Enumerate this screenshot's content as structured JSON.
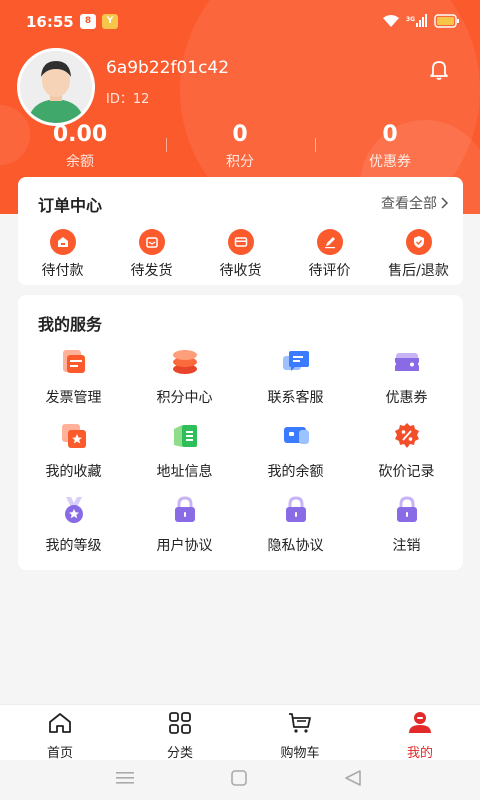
{
  "status_bar": {
    "time": "16:55",
    "badge1": "8",
    "badge2": "Y"
  },
  "profile": {
    "username": "6a9b22f01c42",
    "user_id": "ID：12"
  },
  "stats": [
    {
      "value": "0.00",
      "label": "余额"
    },
    {
      "value": "0",
      "label": "积分"
    },
    {
      "value": "0",
      "label": "优惠券"
    }
  ],
  "orders": {
    "title": "订单中心",
    "view_all": "查看全部",
    "items": [
      {
        "label": "待付款",
        "icon": "wallet-icon"
      },
      {
        "label": "待发货",
        "icon": "package-icon"
      },
      {
        "label": "待收货",
        "icon": "card-icon"
      },
      {
        "label": "待评价",
        "icon": "pen-icon"
      },
      {
        "label": "售后/退款",
        "icon": "shield-check-icon"
      }
    ]
  },
  "services": {
    "title": "我的服务",
    "items": [
      {
        "label": "发票管理",
        "icon": "invoice-icon"
      },
      {
        "label": "积分中心",
        "icon": "coin-stack-icon"
      },
      {
        "label": "联系客服",
        "icon": "chat-icon"
      },
      {
        "label": "优惠券",
        "icon": "coupon-icon"
      },
      {
        "label": "我的收藏",
        "icon": "favorite-icon"
      },
      {
        "label": "地址信息",
        "icon": "address-icon"
      },
      {
        "label": "我的余额",
        "icon": "balance-card-icon"
      },
      {
        "label": "砍价记录",
        "icon": "discount-badge-icon"
      },
      {
        "label": "我的等级",
        "icon": "medal-icon"
      },
      {
        "label": "用户协议",
        "icon": "lock-icon"
      },
      {
        "label": "隐私协议",
        "icon": "lock-icon"
      },
      {
        "label": "注销",
        "icon": "lock-icon"
      }
    ]
  },
  "nav": [
    {
      "label": "首页",
      "icon": "home-icon"
    },
    {
      "label": "分类",
      "icon": "grid-icon"
    },
    {
      "label": "购物车",
      "icon": "cart-icon"
    },
    {
      "label": "我的",
      "icon": "profile-icon"
    }
  ],
  "colors": {
    "primary": "#fb5a2d",
    "active": "#e22a2a",
    "purple": "#8a6be6"
  }
}
